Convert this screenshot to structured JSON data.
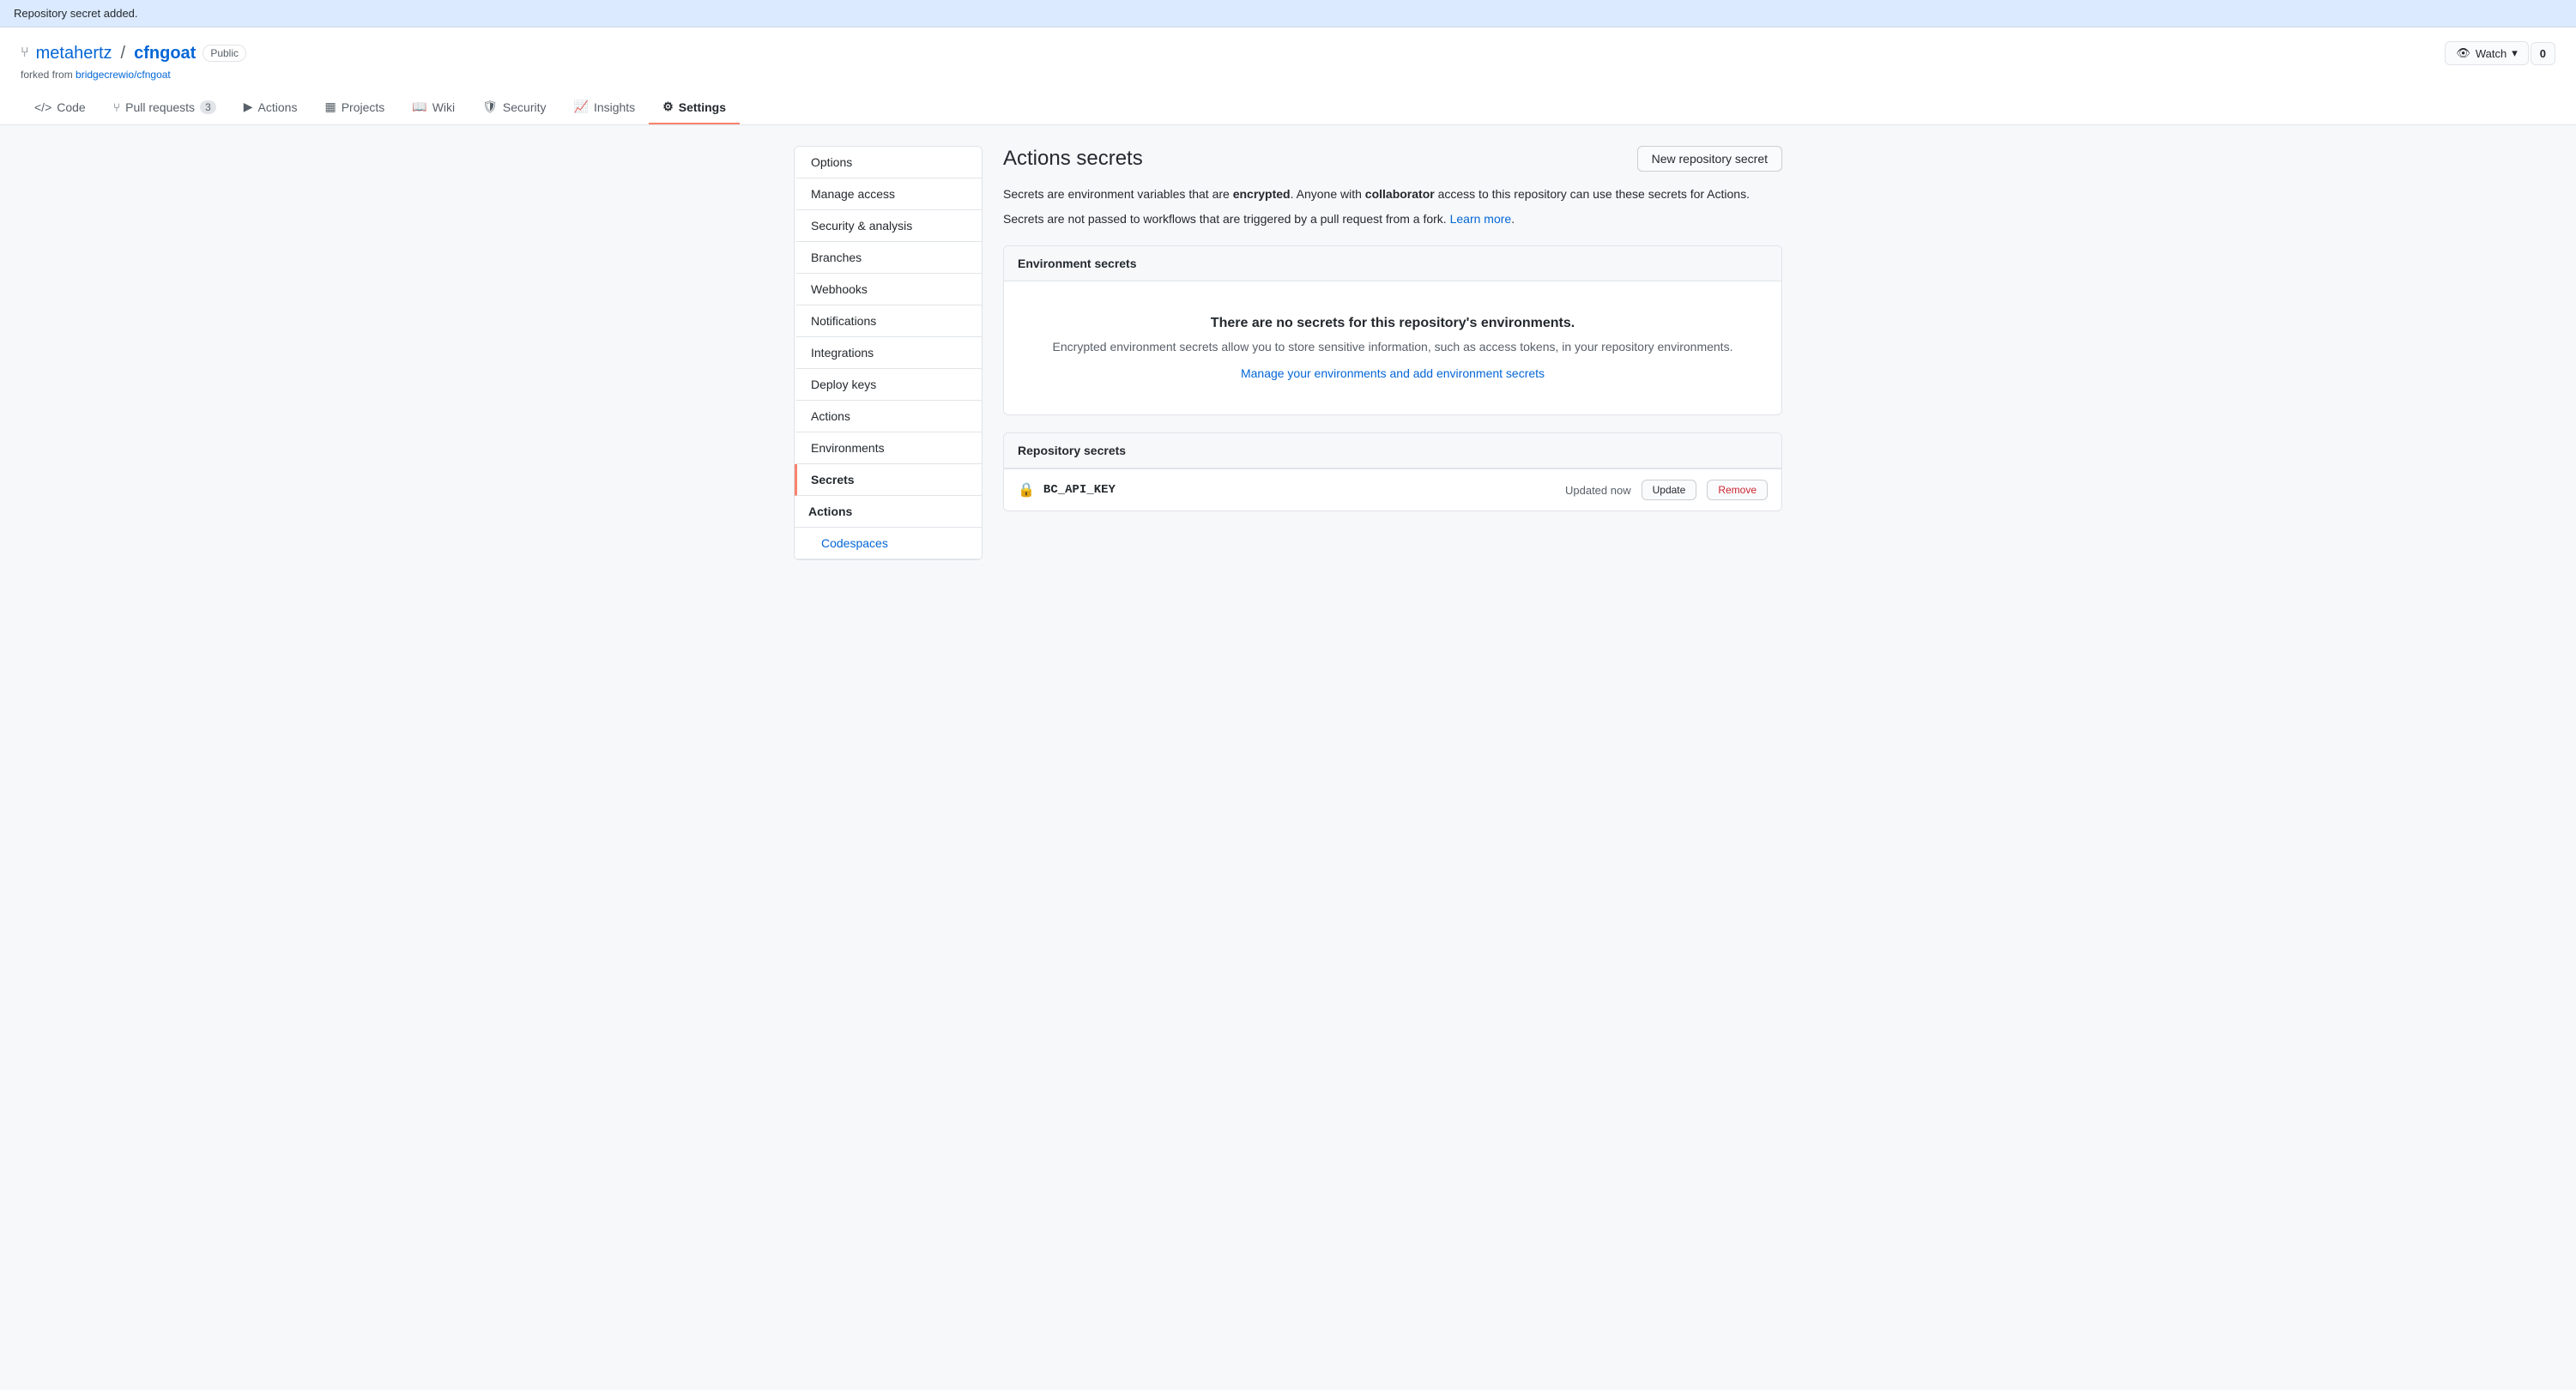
{
  "notification": {
    "message": "Repository secret added."
  },
  "repo": {
    "owner": "metahertz",
    "separator": "/",
    "name": "cfngoat",
    "visibility": "Public",
    "forked_from": "bridgecrewio/cfngoat",
    "forked_label": "forked from"
  },
  "watch_button": {
    "label": "Watch",
    "count": "0"
  },
  "nav": {
    "tabs": [
      {
        "id": "code",
        "label": "Code",
        "icon": "<>",
        "badge": null,
        "active": false
      },
      {
        "id": "pull-requests",
        "label": "Pull requests",
        "icon": "⑂",
        "badge": "3",
        "active": false
      },
      {
        "id": "actions",
        "label": "Actions",
        "icon": "▶",
        "badge": null,
        "active": false
      },
      {
        "id": "projects",
        "label": "Projects",
        "icon": "▦",
        "badge": null,
        "active": false
      },
      {
        "id": "wiki",
        "label": "Wiki",
        "icon": "📖",
        "badge": null,
        "active": false
      },
      {
        "id": "security",
        "label": "Security",
        "icon": "🛡",
        "badge": null,
        "active": false
      },
      {
        "id": "insights",
        "label": "Insights",
        "icon": "📈",
        "badge": null,
        "active": false
      },
      {
        "id": "settings",
        "label": "Settings",
        "icon": "⚙",
        "badge": null,
        "active": true
      }
    ]
  },
  "sidebar": {
    "items": [
      {
        "id": "options",
        "label": "Options",
        "active": false,
        "sub": false
      },
      {
        "id": "manage-access",
        "label": "Manage access",
        "active": false,
        "sub": false
      },
      {
        "id": "security-analysis",
        "label": "Security & analysis",
        "active": false,
        "sub": false
      },
      {
        "id": "branches",
        "label": "Branches",
        "active": false,
        "sub": false
      },
      {
        "id": "webhooks",
        "label": "Webhooks",
        "active": false,
        "sub": false
      },
      {
        "id": "notifications",
        "label": "Notifications",
        "active": false,
        "sub": false
      },
      {
        "id": "integrations",
        "label": "Integrations",
        "active": false,
        "sub": false
      },
      {
        "id": "deploy-keys",
        "label": "Deploy keys",
        "active": false,
        "sub": false
      },
      {
        "id": "actions-settings",
        "label": "Actions",
        "active": false,
        "sub": false
      },
      {
        "id": "environments",
        "label": "Environments",
        "active": false,
        "sub": false
      },
      {
        "id": "secrets",
        "label": "Secrets",
        "active": true,
        "sub": false
      }
    ],
    "sub_section_label": "Actions",
    "sub_items": [
      {
        "id": "codespaces",
        "label": "Codespaces",
        "active": false
      }
    ]
  },
  "content": {
    "title": "Actions secrets",
    "new_secret_button": "New repository secret",
    "description1_pre": "Secrets are environment variables that are ",
    "description1_bold1": "encrypted",
    "description1_mid": ". Anyone with ",
    "description1_bold2": "collaborator",
    "description1_post": " access to this repository can use these secrets for Actions.",
    "description2_pre": "Secrets are not passed to workflows that are triggered by a pull request from a fork. ",
    "description2_link": "Learn more",
    "description2_post": ".",
    "env_secrets": {
      "section_title": "Environment secrets",
      "empty_title": "There are no secrets for this repository's environments.",
      "empty_desc": "Encrypted environment secrets allow you to store sensitive information, such as access tokens, in your repository environments.",
      "empty_link": "Manage your environments and add environment secrets"
    },
    "repo_secrets": {
      "section_title": "Repository secrets",
      "items": [
        {
          "name": "BC_API_KEY",
          "updated": "Updated now",
          "update_btn": "Update",
          "remove_btn": "Remove"
        }
      ]
    }
  }
}
